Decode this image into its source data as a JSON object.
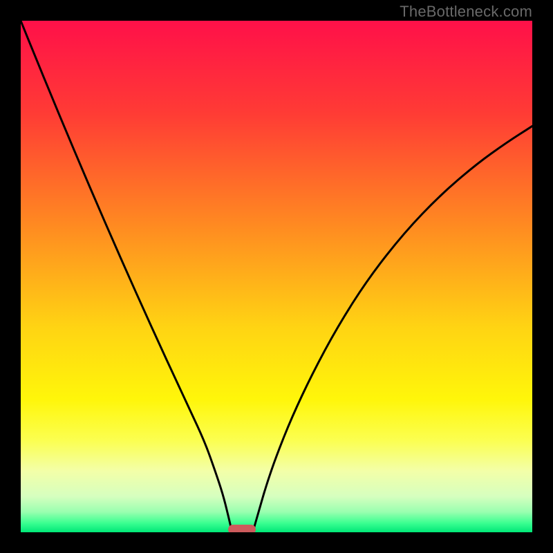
{
  "watermark": {
    "text": "TheBottleneck.com"
  },
  "chart_data": {
    "type": "line",
    "title": "",
    "xlabel": "",
    "ylabel": "",
    "xlim": [
      0,
      100
    ],
    "ylim": [
      0,
      100
    ],
    "gradient_stops": [
      {
        "pct": 0.0,
        "color": "#ff1049"
      },
      {
        "pct": 18.0,
        "color": "#ff3b35"
      },
      {
        "pct": 40.0,
        "color": "#ff8a21"
      },
      {
        "pct": 60.0,
        "color": "#ffd413"
      },
      {
        "pct": 74.0,
        "color": "#fff60a"
      },
      {
        "pct": 82.0,
        "color": "#fbff50"
      },
      {
        "pct": 88.0,
        "color": "#f3ffa8"
      },
      {
        "pct": 93.0,
        "color": "#d6ffbf"
      },
      {
        "pct": 96.0,
        "color": "#9affb0"
      },
      {
        "pct": 98.2,
        "color": "#3bff91"
      },
      {
        "pct": 100.0,
        "color": "#00e777"
      }
    ],
    "series": [
      {
        "name": "left-curve",
        "x": [
          0.0,
          3.0,
          6.0,
          9.0,
          12.0,
          15.0,
          18.0,
          21.0,
          24.0,
          27.0,
          30.0,
          33.0,
          36.0,
          38.0,
          39.5,
          40.5,
          41.2
        ],
        "y": [
          100.0,
          92.6,
          85.3,
          78.1,
          71.0,
          64.0,
          57.1,
          50.3,
          43.6,
          37.0,
          30.5,
          24.1,
          17.6,
          12.0,
          7.5,
          3.5,
          0.5
        ]
      },
      {
        "name": "right-curve",
        "x": [
          45.5,
          46.5,
          48.0,
          50.0,
          53.0,
          57.0,
          62.0,
          68.0,
          75.0,
          82.0,
          89.0,
          95.0,
          100.0
        ],
        "y": [
          0.5,
          4.0,
          9.2,
          15.0,
          22.5,
          31.0,
          40.3,
          49.7,
          58.6,
          65.9,
          71.9,
          76.2,
          79.4
        ]
      }
    ],
    "marker": {
      "x_center": 43.2,
      "y_center": 0.6,
      "width_pct": 5.4,
      "height_pct": 1.9,
      "color": "#cd5b5c"
    }
  }
}
